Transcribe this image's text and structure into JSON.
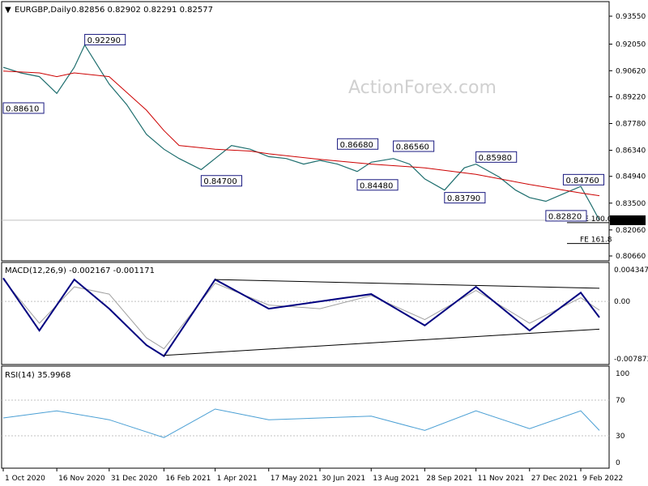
{
  "header": {
    "symbol": "EURGBP,Daily",
    "ohlc": "0.82856 0.82902 0.82291 0.82577"
  },
  "watermark": "ActionForex.com",
  "colors": {
    "price": "#1e6e6e",
    "sma": "#cc0000",
    "macd": "#000080",
    "signal": "#a0a0a0",
    "rsi": "#4a9fd4",
    "label_border": "#1a1a80"
  },
  "price_axis": {
    "ticks": [
      "0.93550",
      "0.92050",
      "0.90620",
      "0.89220",
      "0.87780",
      "0.86340",
      "0.84940",
      "0.83500",
      "0.82060",
      "0.80660"
    ],
    "last": "0.82577"
  },
  "macd_panel": {
    "title": "MACD(12,26,9) -0.002167 -0.001171",
    "ticks": [
      "0.004347",
      "0.00",
      "-0.007873"
    ]
  },
  "rsi_panel": {
    "title": "RSI(14) 35.9968",
    "ticks": [
      "100",
      "70",
      "30",
      "0"
    ]
  },
  "x_axis": {
    "labels": [
      "1 Oct 2020",
      "16 Nov 2020",
      "31 Dec 2020",
      "16 Feb 2021",
      "1 Apr 2021",
      "17 May 2021",
      "30 Jun 2021",
      "13 Aug 2021",
      "28 Sep 2021",
      "11 Nov 2021",
      "27 Dec 2021",
      "9 Feb 2022"
    ]
  },
  "annotations": {
    "labels": [
      "0.92290",
      "0.88610",
      "0.84700",
      "0.86680",
      "0.84480",
      "0.86560",
      "0.85980",
      "0.83790",
      "0.84760",
      "0.82820"
    ],
    "fe": [
      "FE 100.0",
      "FE 161.8"
    ]
  },
  "chart_data": {
    "type": "line",
    "price_series": [
      {
        "date": "1 Oct 2020",
        "close": 0.908
      },
      {
        "date": "16 Oct 2020",
        "close": 0.905
      },
      {
        "date": "1 Nov 2020",
        "close": 0.903
      },
      {
        "date": "16 Nov 2020",
        "close": 0.894
      },
      {
        "date": "1 Dec 2020",
        "close": 0.908
      },
      {
        "date": "10 Dec 2020",
        "close": 0.92
      },
      {
        "date": "31 Dec 2020",
        "close": 0.899
      },
      {
        "date": "15 Jan 2021",
        "close": 0.888
      },
      {
        "date": "1 Feb 2021",
        "close": 0.872
      },
      {
        "date": "16 Feb 2021",
        "close": 0.864
      },
      {
        "date": "1 Mar 2021",
        "close": 0.859
      },
      {
        "date": "20 Mar 2021",
        "close": 0.853
      },
      {
        "date": "1 Apr 2021",
        "close": 0.859
      },
      {
        "date": "15 Apr 2021",
        "close": 0.866
      },
      {
        "date": "1 May 2021",
        "close": 0.864
      },
      {
        "date": "17 May 2021",
        "close": 0.86
      },
      {
        "date": "1 Jun 2021",
        "close": 0.859
      },
      {
        "date": "16 Jun 2021",
        "close": 0.856
      },
      {
        "date": "30 Jun 2021",
        "close": 0.858
      },
      {
        "date": "15 Jul 2021",
        "close": 0.856
      },
      {
        "date": "1 Aug 2021",
        "close": 0.852
      },
      {
        "date": "13 Aug 2021",
        "close": 0.857
      },
      {
        "date": "1 Sep 2021",
        "close": 0.859
      },
      {
        "date": "15 Sep 2021",
        "close": 0.856
      },
      {
        "date": "28 Sep 2021",
        "close": 0.848
      },
      {
        "date": "15 Oct 2021",
        "close": 0.842
      },
      {
        "date": "1 Nov 2021",
        "close": 0.854
      },
      {
        "date": "11 Nov 2021",
        "close": 0.856
      },
      {
        "date": "1 Dec 2021",
        "close": 0.849
      },
      {
        "date": "15 Dec 2021",
        "close": 0.842
      },
      {
        "date": "27 Dec 2021",
        "close": 0.838
      },
      {
        "date": "10 Jan 2022",
        "close": 0.836
      },
      {
        "date": "25 Jan 2022",
        "close": 0.84
      },
      {
        "date": "9 Feb 2022",
        "close": 0.844
      },
      {
        "date": "18 Feb 2022",
        "close": 0.834
      },
      {
        "date": "25 Feb 2022",
        "close": 0.8258
      }
    ],
    "sma_series": [
      {
        "date": "1 Oct 2020",
        "value": 0.906
      },
      {
        "date": "1 Nov 2020",
        "value": 0.905
      },
      {
        "date": "16 Nov 2020",
        "value": 0.903
      },
      {
        "date": "1 Dec 2020",
        "value": 0.905
      },
      {
        "date": "31 Dec 2020",
        "value": 0.903
      },
      {
        "date": "1 Feb 2021",
        "value": 0.885
      },
      {
        "date": "16 Feb 2021",
        "value": 0.874
      },
      {
        "date": "1 Mar 2021",
        "value": 0.866
      },
      {
        "date": "1 Apr 2021",
        "value": 0.864
      },
      {
        "date": "1 May 2021",
        "value": 0.863
      },
      {
        "date": "17 May 2021",
        "value": 0.8615
      },
      {
        "date": "30 Jun 2021",
        "value": 0.8585
      },
      {
        "date": "13 Aug 2021",
        "value": 0.856
      },
      {
        "date": "28 Sep 2021",
        "value": 0.854
      },
      {
        "date": "11 Nov 2021",
        "value": 0.8505
      },
      {
        "date": "27 Dec 2021",
        "value": 0.845
      },
      {
        "date": "9 Feb 2022",
        "value": 0.8405
      },
      {
        "date": "25 Feb 2022",
        "value": 0.839
      }
    ],
    "macd_series": [
      {
        "date": "1 Oct 2020",
        "macd": 0.0032,
        "signal": 0.003
      },
      {
        "date": "1 Nov 2020",
        "macd": -0.004,
        "signal": -0.003
      },
      {
        "date": "1 Dec 2020",
        "macd": 0.003,
        "signal": 0.002
      },
      {
        "date": "31 Dec 2020",
        "macd": -0.001,
        "signal": 0.001
      },
      {
        "date": "1 Feb 2021",
        "macd": -0.006,
        "signal": -0.005
      },
      {
        "date": "16 Feb 2021",
        "macd": -0.0075,
        "signal": -0.0065
      },
      {
        "date": "1 Apr 2021",
        "macd": 0.003,
        "signal": 0.0025
      },
      {
        "date": "17 May 2021",
        "macd": -0.001,
        "signal": -0.0005
      },
      {
        "date": "30 Jun 2021",
        "macd": 0.0,
        "signal": -0.001
      },
      {
        "date": "13 Aug 2021",
        "macd": 0.001,
        "signal": 0.0008
      },
      {
        "date": "28 Sep 2021",
        "macd": -0.0033,
        "signal": -0.0025
      },
      {
        "date": "11 Nov 2021",
        "macd": 0.002,
        "signal": 0.0015
      },
      {
        "date": "27 Dec 2021",
        "macd": -0.004,
        "signal": -0.003
      },
      {
        "date": "9 Feb 2022",
        "macd": 0.0012,
        "signal": 0.0005
      },
      {
        "date": "25 Feb 2022",
        "macd": -0.0022,
        "signal": -0.0012
      }
    ],
    "macd_trendlines": [
      {
        "from": {
          "date": "1 Apr 2021",
          "value": 0.003
        },
        "to": {
          "date": "25 Feb 2022",
          "value": 0.0018
        }
      },
      {
        "from": {
          "date": "16 Feb 2021",
          "value": -0.0074
        },
        "to": {
          "date": "25 Feb 2022",
          "value": -0.0038
        }
      }
    ],
    "rsi_series": [
      {
        "date": "1 Oct 2020",
        "value": 50
      },
      {
        "date": "16 Nov 2020",
        "value": 58
      },
      {
        "date": "31 Dec 2020",
        "value": 48
      },
      {
        "date": "16 Feb 2021",
        "value": 28
      },
      {
        "date": "1 Apr 2021",
        "value": 60
      },
      {
        "date": "17 May 2021",
        "value": 48
      },
      {
        "date": "30 Jun 2021",
        "value": 50
      },
      {
        "date": "13 Aug 2021",
        "value": 52
      },
      {
        "date": "28 Sep 2021",
        "value": 36
      },
      {
        "date": "11 Nov 2021",
        "value": 58
      },
      {
        "date": "27 Dec 2021",
        "value": 38
      },
      {
        "date": "9 Feb 2022",
        "value": 58
      },
      {
        "date": "25 Feb 2022",
        "value": 36
      }
    ],
    "price_ylim": [
      0.8066,
      0.9355
    ],
    "macd_ylim": [
      -0.007873,
      0.004347
    ],
    "rsi_ylim": [
      0,
      100
    ],
    "rsi_levels": [
      70,
      30
    ],
    "annotated_levels": [
      {
        "label": "0.92290",
        "date": "10 Dec 2020",
        "value": 0.9229
      },
      {
        "label": "0.88610",
        "date": "1 Oct 2020",
        "value": 0.8861
      },
      {
        "label": "0.84700",
        "date": "20 Mar 2021",
        "value": 0.847
      },
      {
        "label": "0.86680",
        "date": "15 Jul 2021",
        "value": 0.8668
      },
      {
        "label": "0.84480",
        "date": "1 Aug 2021",
        "value": 0.8448
      },
      {
        "label": "0.86560",
        "date": "1 Sep 2021",
        "value": 0.8656
      },
      {
        "label": "0.85980",
        "date": "11 Nov 2021",
        "value": 0.8598
      },
      {
        "label": "0.83790",
        "date": "15 Oct 2021",
        "value": 0.8379
      },
      {
        "label": "0.84760",
        "date": "25 Jan 2022",
        "value": 0.8476
      },
      {
        "label": "0.82820",
        "date": "10 Jan 2022",
        "value": 0.8282
      }
    ],
    "fe_levels": [
      {
        "label": "FE 100.0",
        "value": 0.8245
      },
      {
        "label": "FE 161.8",
        "value": 0.8133
      }
    ]
  }
}
